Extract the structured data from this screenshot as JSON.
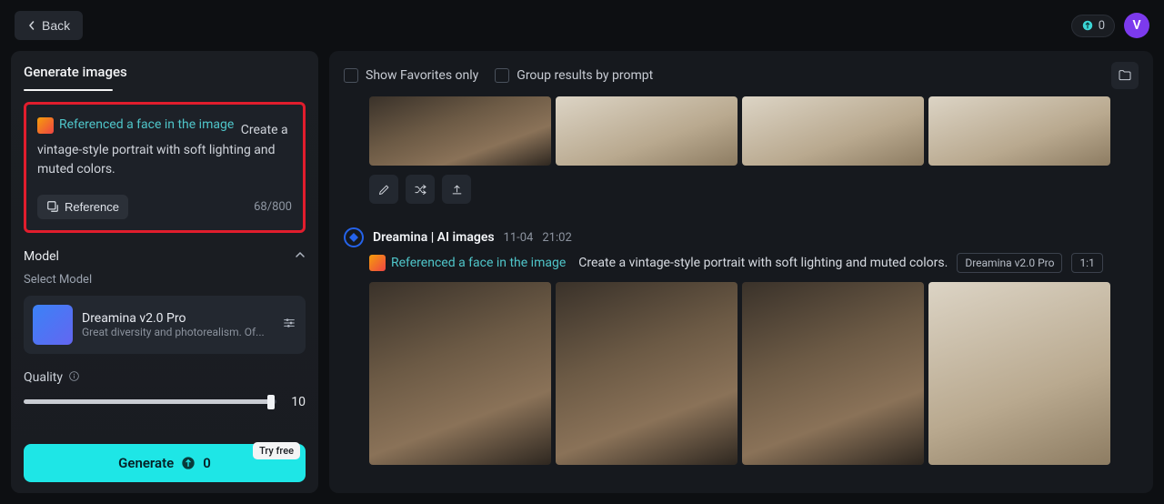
{
  "topbar": {
    "back_label": "Back",
    "credits_value": "0",
    "avatar_initial": "V"
  },
  "sidebar": {
    "title": "Generate images",
    "ref_tag_label": "Referenced a face in the image",
    "prompt_text": "Create a vintage-style portrait with soft lighting and muted colors.",
    "reference_btn": "Reference",
    "char_count": "68/800",
    "model_section_label": "Model",
    "select_model_label": "Select Model",
    "model_name": "Dreamina v2.0 Pro",
    "model_desc": "Great diversity and photorealism. Of...",
    "quality_label": "Quality",
    "quality_value": "10",
    "generate_label": "Generate",
    "generate_cost": "0",
    "try_free_label": "Try free"
  },
  "main": {
    "show_favorites_label": "Show Favorites only",
    "group_results_label": "Group results by prompt",
    "group": {
      "title": "Dreamina | AI images",
      "date": "11-04",
      "time": "21:02",
      "ref_tag": "Referenced a face in the image",
      "prompt": "Create a vintage-style portrait with soft lighting and muted colors.",
      "model_badge": "Dreamina v2.0 Pro",
      "ratio_badge": "1:1"
    }
  }
}
